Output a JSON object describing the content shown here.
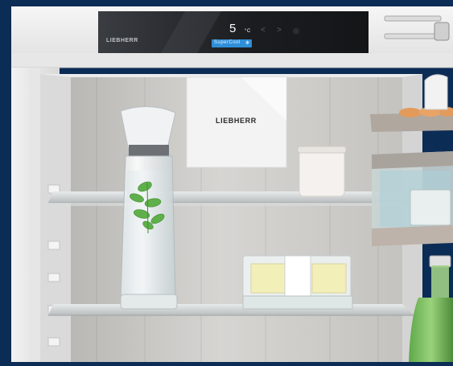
{
  "brand": "LIEBHERR",
  "control_panel": {
    "brand_label": "LIEBHERR",
    "temperature": "5",
    "temperature_unit": "°C",
    "supercool_label": "SuperCool",
    "supercool_mark": "✻",
    "left_arrow": "<",
    "right_arrow": ">",
    "extra_icon": "◎"
  },
  "interior": {
    "info_card_brand": "LIEBHERR"
  },
  "colors": {
    "frame_border": "#0b2c55",
    "panel_background": "#1a1c1f",
    "supercool_accent": "#2f8fd8",
    "interior_wall": "#cfcfcc"
  },
  "icons": {
    "supercool": "snowflake-icon",
    "prev": "chevron-left-icon",
    "next": "chevron-right-icon",
    "extra": "circle-icon"
  }
}
